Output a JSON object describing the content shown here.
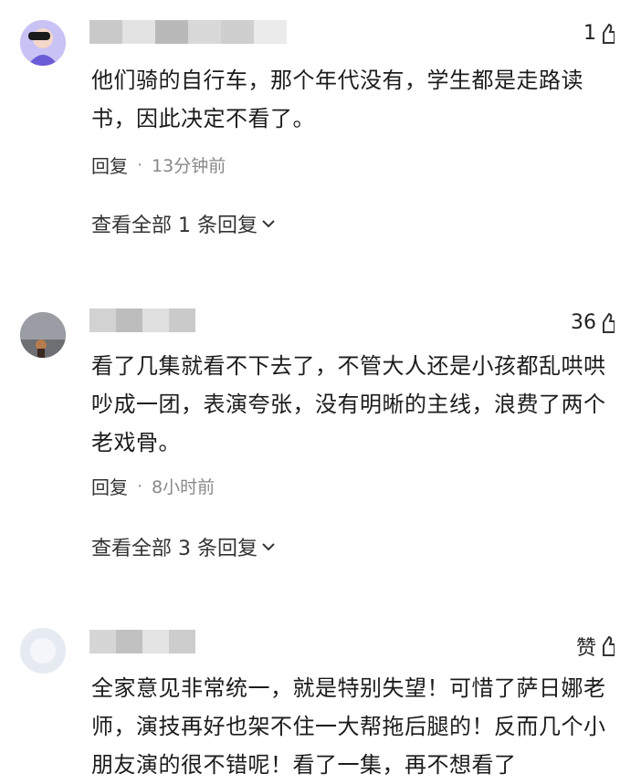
{
  "comments": [
    {
      "like": "1",
      "text": "他们骑的自行车，那个年代没有，学生都是走路读书，因此决定不看了。",
      "reply_label": "回复",
      "time": "13分钟前",
      "expand": "查看全部 1 条回复"
    },
    {
      "like": "36",
      "text": "看了几集就看不下去了，不管大人还是小孩都乱哄哄吵成一团，表演夸张，没有明晰的主线，浪费了两个老戏骨。",
      "reply_label": "回复",
      "time": "8小时前",
      "expand": "查看全部 3 条回复"
    },
    {
      "like": "赞",
      "text": "全家意见非常统一，就是特别失望！可惜了萨日娜老师，演技再好也架不住一大帮拖后腿的！反而几个小朋友演的很不错呢！看了一集，再不想看了"
    }
  ],
  "icons": {
    "like": "thumbs-up-icon",
    "expand": "chevron-down-icon"
  },
  "colors": {
    "text": "#1c1c1c",
    "meta": "#888888",
    "background": "#ffffff"
  }
}
